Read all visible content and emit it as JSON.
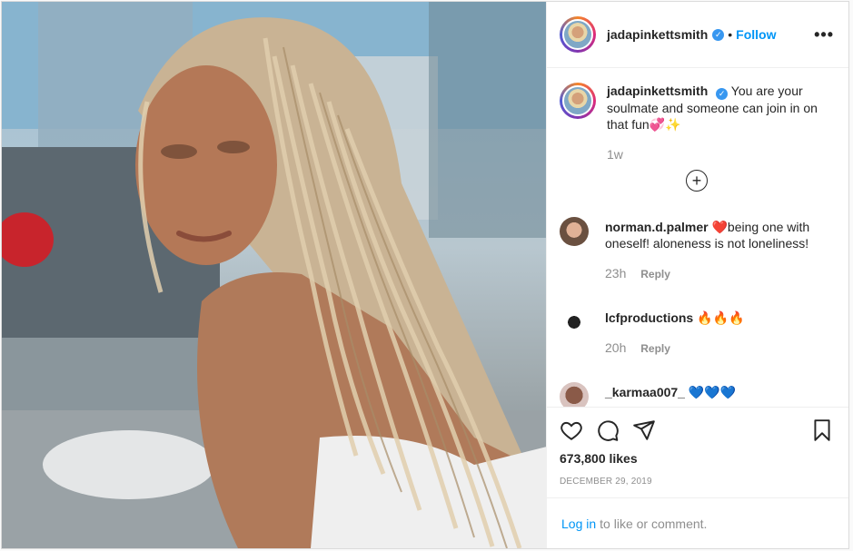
{
  "post": {
    "photo_alt": "portrait photo",
    "author": {
      "username": "jadapinkettsmith",
      "verified_icon": "verified-badge-icon",
      "follow_label": "Follow",
      "separator": "•"
    },
    "more_icon": "more-options-icon",
    "more_label": "•••",
    "caption": {
      "username": "jadapinkettsmith",
      "text": "You are your soulmate and someone can join in on that fun💞✨",
      "time": "1w"
    },
    "load_more_icon": "load-more-plus-icon",
    "load_more_label": "+",
    "comments": [
      {
        "username": "norman.d.palmer",
        "text": "❤️being one with oneself! aloneness is not loneliness!",
        "time": "23h",
        "reply_label": "Reply"
      },
      {
        "username": "lcfproductions",
        "text": "🔥🔥🔥",
        "time": "20h",
        "reply_label": "Reply"
      },
      {
        "username": "_karmaa007_",
        "text": "💙💙💙"
      }
    ],
    "actions": {
      "like_icon": "heart-icon",
      "comment_icon": "comment-icon",
      "share_icon": "share-icon",
      "save_icon": "bookmark-icon"
    },
    "likes": "673,800 likes",
    "date": "DECEMBER 29, 2019",
    "login": {
      "link": "Log in",
      "text": "to like or comment."
    }
  },
  "colors": {
    "link_blue": "#0095f6",
    "verified_blue": "#3897f0",
    "muted_grey": "#8e8e8e",
    "text_dark": "#262626"
  }
}
